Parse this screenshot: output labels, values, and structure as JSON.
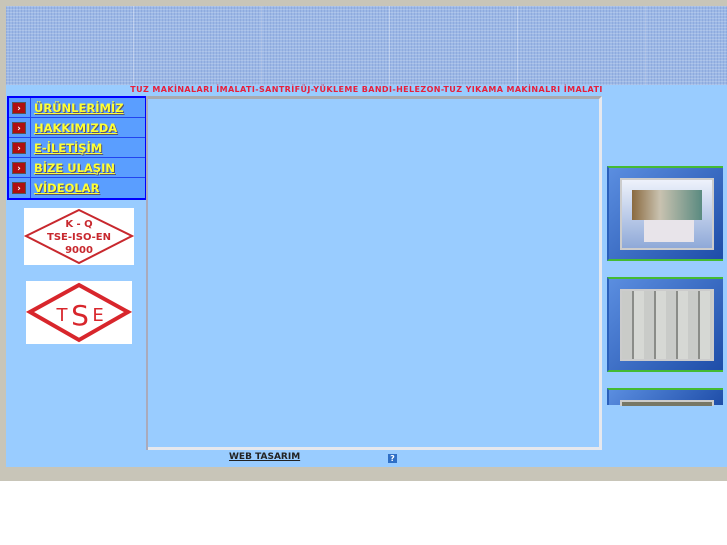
{
  "tagline": "TUZ MAKİNALARI İMALATI-SANTRİFÜJ-YÜKLEME BANDI-HELEZON-TUZ YIKAMA MAKİNALRI İMALATI",
  "menu": [
    {
      "label": "ÜRÜNLERİMİZ",
      "icon": "chevron-right-icon"
    },
    {
      "label": "HAKKIMIZDA",
      "icon": "chevron-right-icon"
    },
    {
      "label": "E-İLETİŞİM",
      "icon": "chevron-right-icon"
    },
    {
      "label": "BİZE ULAŞIN",
      "icon": "chevron-right-icon"
    },
    {
      "label": "VİDEOLAR",
      "icon": "chevron-right-icon"
    }
  ],
  "logos": {
    "kq": [
      "K - Q",
      "TSE-ISO-EN",
      "9000"
    ],
    "tse": "TSE"
  },
  "footer": {
    "link": "WEB TASARIM",
    "help_icon": "?"
  },
  "colors": {
    "page_bg": "#99ccff",
    "menu_bg": "#5a9eff",
    "menu_text": "#ffff33",
    "tagline": "#e8203a"
  }
}
